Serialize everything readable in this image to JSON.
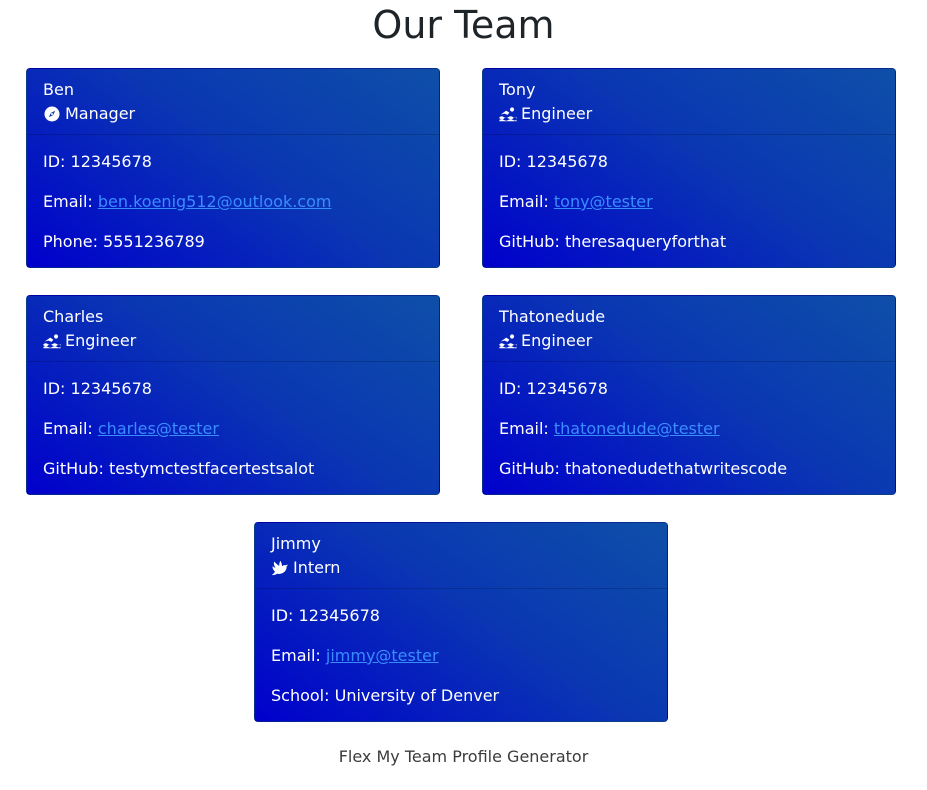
{
  "page": {
    "title": "Our Team",
    "footer": "Flex My Team Profile Generator"
  },
  "colors": {
    "card_gradient_start": "#0e4fa8",
    "card_gradient_end": "#0000cc",
    "link": "#3a8dff",
    "text_on_card": "#ffffff"
  },
  "cards": [
    {
      "name": "Ben",
      "role": "Manager",
      "role_icon": "compass-icon",
      "id_label": "ID:",
      "id": "12345678",
      "email_label": "Email:",
      "email": "ben.koenig512@outlook.com",
      "extra_label": "Phone:",
      "extra_value": "5551236789"
    },
    {
      "name": "Tony",
      "role": "Engineer",
      "role_icon": "swimmer-icon",
      "id_label": "ID:",
      "id": "12345678",
      "email_label": "Email:",
      "email": "tony@tester",
      "extra_label": "GitHub:",
      "extra_value": "theresaqueryforthat"
    },
    {
      "name": "Charles",
      "role": "Engineer",
      "role_icon": "swimmer-icon",
      "id_label": "ID:",
      "id": "12345678",
      "email_label": "Email:",
      "email": "charles@tester",
      "extra_label": "GitHub:",
      "extra_value": "testymctestfacertestsalot"
    },
    {
      "name": "Thatonedude",
      "role": "Engineer",
      "role_icon": "swimmer-icon",
      "id_label": "ID:",
      "id": "12345678",
      "email_label": "Email:",
      "email": "thatonedude@tester",
      "extra_label": "GitHub:",
      "extra_value": "thatonedudethatwritescode"
    },
    {
      "name": "Jimmy",
      "role": "Intern",
      "role_icon": "dove-icon",
      "id_label": "ID:",
      "id": "12345678",
      "email_label": "Email:",
      "email": "jimmy@tester",
      "extra_label": "School:",
      "extra_value": "University of Denver"
    }
  ]
}
